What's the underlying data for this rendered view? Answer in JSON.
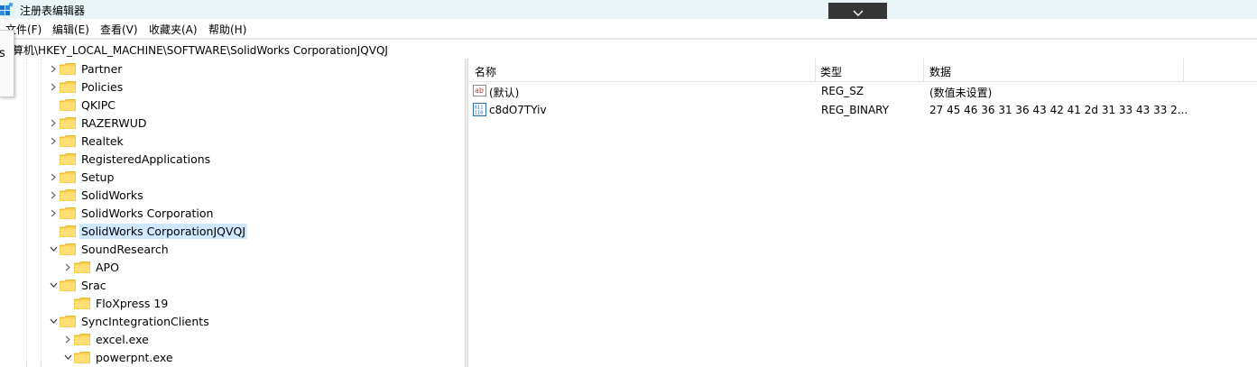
{
  "window": {
    "title": "注册表编辑器"
  },
  "menu": [
    "文件(F)",
    "编辑(E)",
    "查看(V)",
    "收藏夹(A)",
    "帮助(H)"
  ],
  "address": "算机\\HKEY_LOCAL_MACHINE\\SOFTWARE\\SolidWorks CorporationJQVQJ",
  "popup_fragment": "s",
  "tree": [
    {
      "label": "Partner",
      "chevron": "right"
    },
    {
      "label": "Policies",
      "chevron": "right"
    },
    {
      "label": "QKIPC",
      "chevron": "none"
    },
    {
      "label": "RAZERWUD",
      "chevron": "right"
    },
    {
      "label": "Realtek",
      "chevron": "right"
    },
    {
      "label": "RegisteredApplications",
      "chevron": "none"
    },
    {
      "label": "Setup",
      "chevron": "right"
    },
    {
      "label": "SolidWorks",
      "chevron": "right"
    },
    {
      "label": "SolidWorks Corporation",
      "chevron": "right"
    },
    {
      "label": "SolidWorks CorporationJQVQJ",
      "chevron": "none",
      "selected": true
    },
    {
      "label": "SoundResearch",
      "chevron": "down"
    },
    {
      "label": "APO",
      "chevron": "right",
      "indent": 1
    },
    {
      "label": "Srac",
      "chevron": "down"
    },
    {
      "label": "FloXpress 19",
      "chevron": "none",
      "indent": 1
    },
    {
      "label": "SyncIntegrationClients",
      "chevron": "down"
    },
    {
      "label": "excel.exe",
      "chevron": "right",
      "indent": 1
    },
    {
      "label": "powerpnt.exe",
      "chevron": "down",
      "indent": 1
    }
  ],
  "list": {
    "headers": {
      "name": "名称",
      "type": "类型",
      "data": "数据"
    },
    "rows": [
      {
        "icon": "string-value-icon",
        "name": "(默认)",
        "type": "REG_SZ",
        "data": "(数值未设置)"
      },
      {
        "icon": "binary-value-icon",
        "name": "c8dO7TYiv",
        "type": "REG_BINARY",
        "data": "27 45 46 36 31 36 43 42 41 2d 31 33 43 33 2..."
      }
    ]
  },
  "colors": {
    "titlebar": "#eaf5f8",
    "selection": "#cde8ff",
    "folder": "#ffd04b",
    "collapse_button": "#353535"
  }
}
